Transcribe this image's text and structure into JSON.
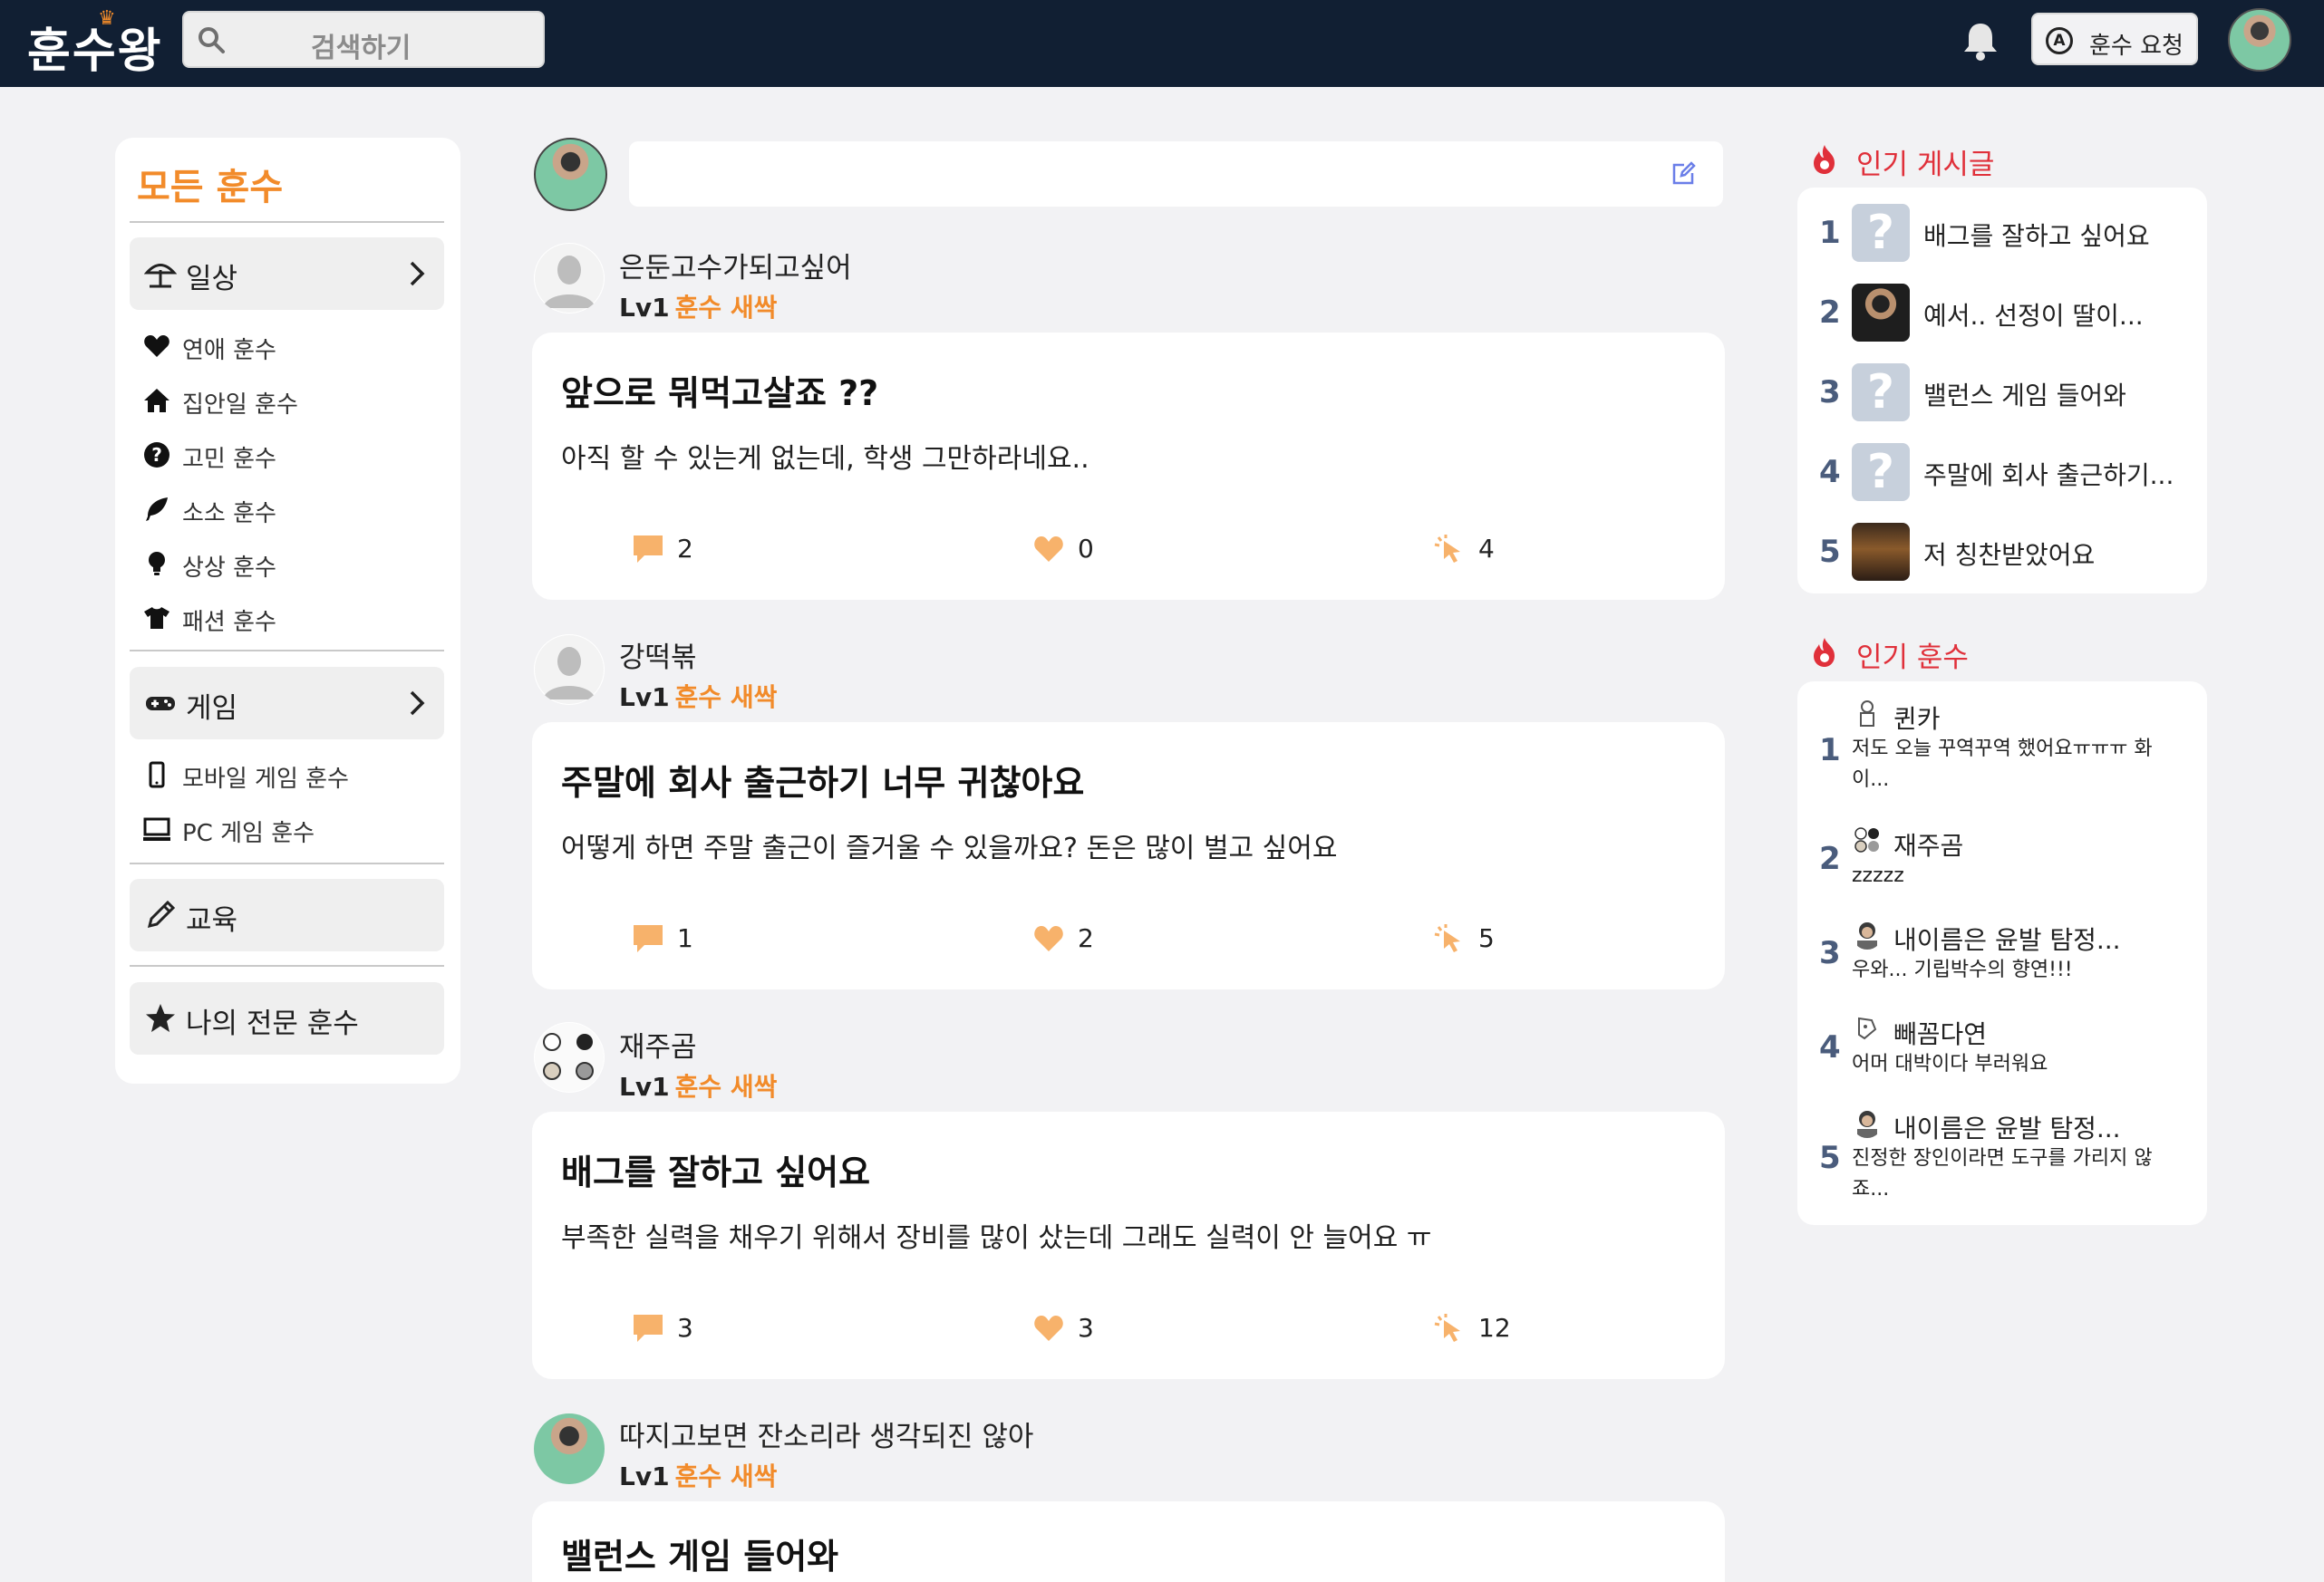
{
  "header": {
    "logo": "훈수왕",
    "search_placeholder": "검색하기",
    "request_button": "훈수 요청",
    "request_icon_letter": "A"
  },
  "sidebar": {
    "title": "모든 훈수",
    "categories": [
      {
        "label": "일상",
        "icon": "parasol-icon",
        "items": [
          {
            "label": "연애 훈수",
            "icon": "heart-icon"
          },
          {
            "label": "집안일 훈수",
            "icon": "home-icon"
          },
          {
            "label": "고민 훈수",
            "icon": "question-icon"
          },
          {
            "label": "소소 훈수",
            "icon": "feather-icon"
          },
          {
            "label": "상상 훈수",
            "icon": "lightbulb-icon"
          },
          {
            "label": "패션 훈수",
            "icon": "tshirt-icon"
          }
        ]
      },
      {
        "label": "게임",
        "icon": "gamepad-icon",
        "items": [
          {
            "label": "모바일 게임 훈수",
            "icon": "mobile-icon"
          },
          {
            "label": "PC 게임 훈수",
            "icon": "desktop-icon"
          }
        ]
      },
      {
        "label": "교육",
        "icon": "pencil-icon",
        "items": []
      },
      {
        "label": "나의 전문 훈수",
        "icon": "star-icon",
        "items": []
      }
    ]
  },
  "feed": {
    "posts": [
      {
        "author": "은둔고수가되고싶어",
        "level": "Lv1",
        "rank": "훈수 새싹",
        "title": "앞으로 뭐먹고살죠 ??",
        "body": "아직 할 수 있는게 없는데, 학생 그만하라네요..",
        "comments": "2",
        "likes": "0",
        "clicks": "4"
      },
      {
        "author": "강떡볶",
        "level": "Lv1",
        "rank": "훈수 새싹",
        "title": "주말에 회사 출근하기 너무 귀찮아요",
        "body": "어떻게 하면 주말 출근이 즐거울 수 있을까요? 돈은 많이 벌고 싶어요",
        "comments": "1",
        "likes": "2",
        "clicks": "5"
      },
      {
        "author": "재주곰",
        "level": "Lv1",
        "rank": "훈수 새싹",
        "title": "배그를 잘하고 싶어요",
        "body": "부족한 실력을 채우기 위해서 장비를 많이 샀는데 그래도 실력이 안 늘어요 ㅠ",
        "comments": "3",
        "likes": "3",
        "clicks": "12"
      },
      {
        "author": "따지고보면 잔소리라 생각되진 않아",
        "level": "Lv1",
        "rank": "훈수 새싹",
        "title": "밸런스 게임 들어와"
      }
    ]
  },
  "popular_posts": {
    "heading": "인기 게시글",
    "items": [
      {
        "rank": "1",
        "title": "배그를 잘하고 싶어요",
        "thumb": "question"
      },
      {
        "rank": "2",
        "title": "예서.. 선정이 딸이...",
        "thumb": "photo"
      },
      {
        "rank": "3",
        "title": "밸런스 게임 들어와",
        "thumb": "question"
      },
      {
        "rank": "4",
        "title": "주말에 회사 출근하기...",
        "thumb": "question"
      },
      {
        "rank": "5",
        "title": "저 칭찬받았어요",
        "thumb": "photo"
      }
    ]
  },
  "popular_hunsu": {
    "heading": "인기 훈수",
    "items": [
      {
        "rank": "1",
        "name": "퀸카",
        "text": "저도 오늘 꾸역꾸역 했어요ㅠㅠㅠ 화이..."
      },
      {
        "rank": "2",
        "name": "재주곰",
        "text": "zzzzz"
      },
      {
        "rank": "3",
        "name": "내이름은 윤발 탐정...",
        "text": "우와... 기립박수의 향연!!!"
      },
      {
        "rank": "4",
        "name": "빼꼼다연",
        "text": "어머 대박이다 부러워요"
      },
      {
        "rank": "5",
        "name": "내이름은 윤발 탐정...",
        "text": "진정한 장인이라면 도구를 가리지 않죠..."
      }
    ]
  },
  "colors": {
    "topbar": "#111f33",
    "accent_orange": "#f28b2a",
    "hot_red": "#e0303a",
    "stat_orange": "#f7b26b",
    "rank_number": "#4a5c7c"
  }
}
